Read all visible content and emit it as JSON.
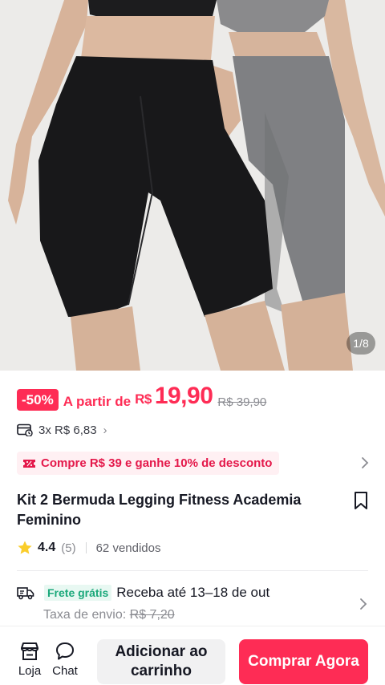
{
  "gallery": {
    "counter": "1/8"
  },
  "price": {
    "discount_badge": "-50%",
    "from_label": "A partir de",
    "currency": "R$",
    "current": "19,90",
    "original": "R$ 39,90"
  },
  "installments": {
    "text": "3x R$ 6,83"
  },
  "promo": {
    "text": "Compre R$ 39 e ganhe 10% de desconto"
  },
  "product": {
    "title": "Kit 2 Bermuda Legging Fitness  Academia Feminino",
    "rating": "4.4",
    "review_count": "(5)",
    "sold": "62 vendidos"
  },
  "shipping": {
    "free_badge": "Frete grátis",
    "delivery": "Receba até 13–18 de out",
    "fee_label": "Taxa de envio:",
    "fee_old": "R$ 7,20"
  },
  "bottom_bar": {
    "store_label": "Loja",
    "chat_label": "Chat",
    "add_to_cart": "Adicionar ao carrinho",
    "buy_now": "Comprar Agora"
  },
  "colors": {
    "accent": "#fe2c55",
    "promo_bg": "#fff0f3",
    "free_shipping": "#1aa87a",
    "star": "#facd2b"
  }
}
